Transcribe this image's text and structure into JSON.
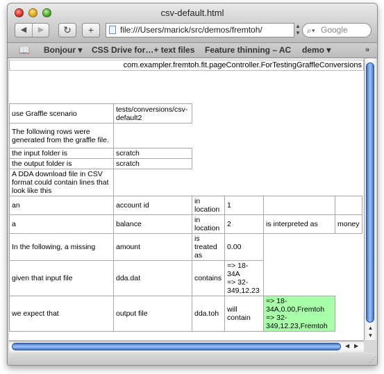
{
  "window": {
    "title": "csv-default.html"
  },
  "toolbar": {
    "back_icon": "◀",
    "forward_icon": "▶",
    "reload_icon": "↻",
    "add_icon": "+",
    "url": "file:///Users/marick/src/demos/fremtoh/",
    "search_placeholder": "Google"
  },
  "bookmarks": {
    "items": [
      "Bonjour ▾",
      "CSS Drive for…+ text files",
      "Feature thinning – AC",
      "demo ▾"
    ],
    "more": "»"
  },
  "page": {
    "fixture_class": "com.exampler.fremtoh.fit.pageController.ForTestingGraffleConversions",
    "rows": [
      [
        "use Graffle scenario",
        "tests/conversions/csv-default2"
      ],
      [
        "The following rows were generated from the graffle file."
      ],
      [
        "the input folder is",
        "scratch"
      ],
      [
        "the output folder is",
        "scratch"
      ],
      [
        "A DDA download file in CSV format could contain lines that look like this"
      ],
      [
        "an",
        "account id",
        "in location",
        "1"
      ],
      [
        "a",
        "balance",
        "in location",
        "2",
        "is interpreted as",
        "money"
      ],
      [
        "In the following, a missing",
        "amount",
        "is treated as",
        "0.00"
      ],
      [
        "given that input file",
        "dda.dat",
        "contains",
        "=> 18-34A\n=> 32-349,12.23"
      ],
      [
        "we expect that",
        "output file",
        "dda.toh",
        "will contain",
        "=> 18-34A,0.00,Fremtoh\n=> 32-349,12.23,Fremtoh"
      ]
    ]
  }
}
